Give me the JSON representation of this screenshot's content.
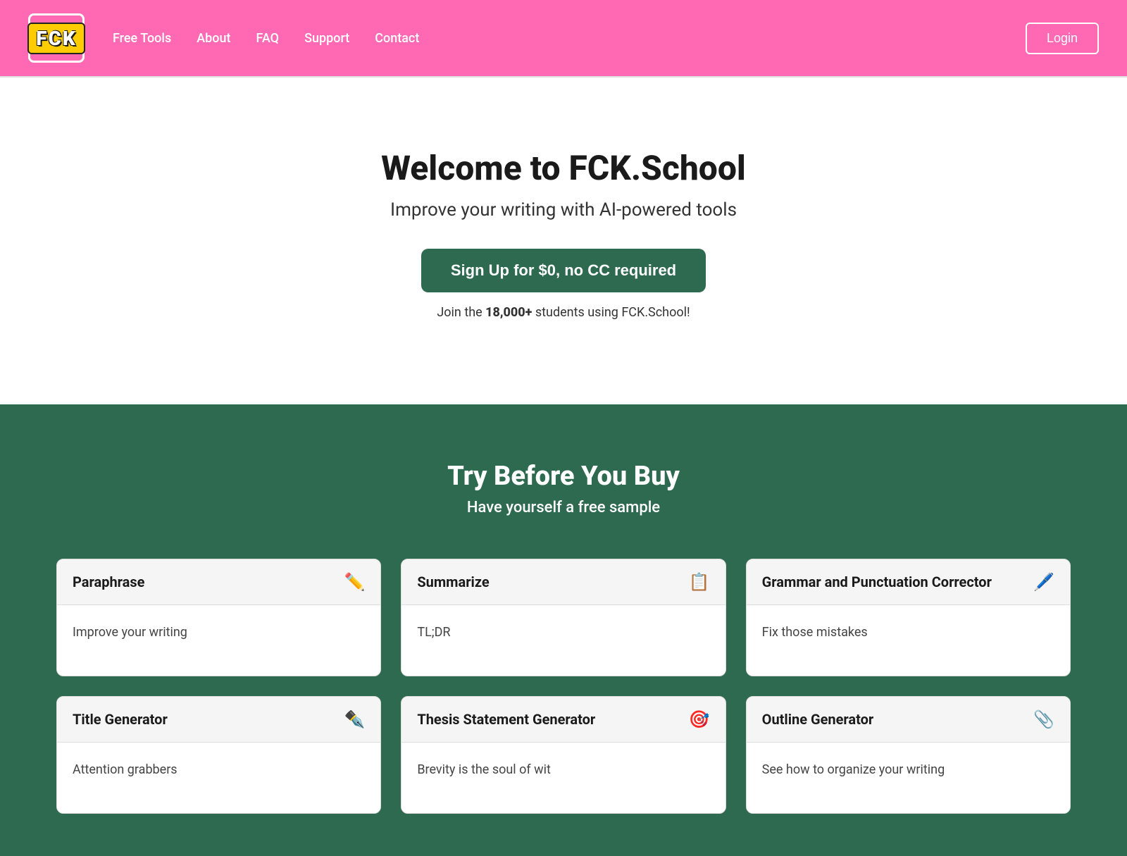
{
  "nav": {
    "logo": "FCK",
    "links": [
      {
        "label": "Free Tools",
        "name": "free-tools"
      },
      {
        "label": "About",
        "name": "about"
      },
      {
        "label": "FAQ",
        "name": "faq"
      },
      {
        "label": "Support",
        "name": "support"
      },
      {
        "label": "Contact",
        "name": "contact"
      }
    ],
    "login_label": "Login"
  },
  "hero": {
    "title": "Welcome to FCK.School",
    "subtitle": "Improve your writing with AI-powered tools",
    "signup_label": "Sign Up for $0, no CC required",
    "join_text_prefix": "Join the ",
    "join_count": "18,000+",
    "join_text_suffix": " students using FCK.School!"
  },
  "tools_section": {
    "heading": "Try Before You Buy",
    "subheading": "Have yourself a free sample",
    "tools": [
      {
        "name": "paraphrase",
        "title": "Paraphrase",
        "icon": "✏️",
        "description": "Improve your writing"
      },
      {
        "name": "summarize",
        "title": "Summarize",
        "icon": "📋",
        "description": "TL;DR"
      },
      {
        "name": "grammar-corrector",
        "title": "Grammar and Punctuation Corrector",
        "icon": "🖊️",
        "description": "Fix those mistakes"
      },
      {
        "name": "title-generator",
        "title": "Title Generator",
        "icon": "✒️",
        "description": "Attention grabbers"
      },
      {
        "name": "thesis-statement-generator",
        "title": "Thesis Statement Generator",
        "icon": "🎯",
        "description": "Brevity is the soul of wit"
      },
      {
        "name": "outline-generator",
        "title": "Outline Generator",
        "icon": "📎",
        "description": "See how to organize your writing"
      }
    ]
  }
}
